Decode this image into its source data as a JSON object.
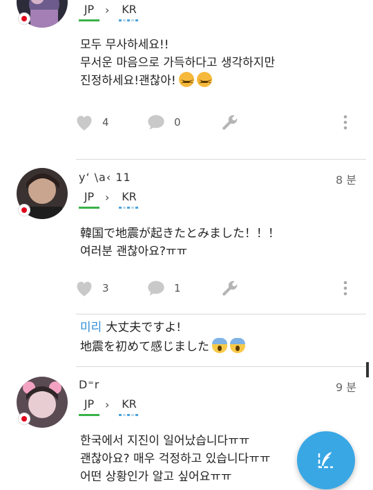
{
  "posts": [
    {
      "username": "",
      "time": "",
      "lang_from": "JP",
      "lang_to": "KR",
      "lines": [
        "모두 무사하세요!!",
        "무서운 마음으로 가득하다고 생각하지만",
        "진정하세요!괜찮아!"
      ],
      "likes": "4",
      "comments": "0"
    },
    {
      "username": "y‘ \\a‹ 11",
      "time": "8 분",
      "lang_from": "JP",
      "lang_to": "KR",
      "lines": [
        "韓国で地震が起きたとみました！！！",
        "여러분 괜찮아요?ㅠㅠ"
      ],
      "likes": "3",
      "comments": "1",
      "reply": {
        "user": "미리",
        "lines": [
          "大丈夫ですよ!",
          "地震を初めて感じました"
        ]
      }
    },
    {
      "username": "D⁼r",
      "time": "9 분",
      "lang_from": "JP",
      "lang_to": "KR",
      "lines": [
        "한국에서 지진이 일어났습니다ㅠㅠ",
        "괜찮아요? 매우 걱정하고 있습니다ㅠㅠ",
        "어떤 상황인가 알고 싶어요ㅠㅠ"
      ]
    }
  ],
  "icons": {
    "like": "heart-icon",
    "comment": "speech-bubble-icon",
    "correct": "wrench-icon",
    "more": "more-vert-icon",
    "fab": "quill-pen-icon"
  },
  "colors": {
    "accent": "#39a7e4",
    "reply_user": "#2e8fd8",
    "source_lang_bar": "#39b24a",
    "online_flag": "#e0001b"
  }
}
